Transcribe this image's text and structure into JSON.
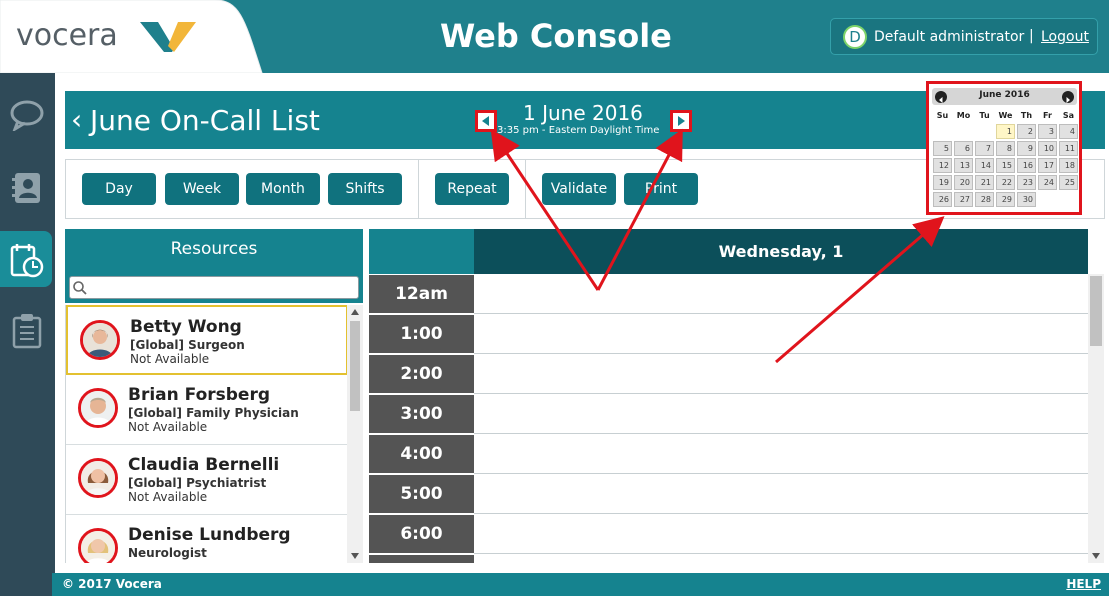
{
  "header": {
    "logo_text": "vocera",
    "title": "Web Console",
    "user_initial": "D",
    "user_name": "Default administrator",
    "separator": "|",
    "logout_label": "Logout"
  },
  "nav": {
    "items": [
      "chat-icon",
      "contacts-icon",
      "schedule-icon",
      "checklist-icon"
    ],
    "active": "schedule-icon"
  },
  "title_bar": {
    "back": "‹",
    "title": "June On-Call List",
    "date": "1 June 2016",
    "time_line": "3:35 pm - Eastern Daylight Time"
  },
  "toolbar": {
    "day": "Day",
    "week": "Week",
    "month": "Month",
    "shifts": "Shifts",
    "repeat": "Repeat",
    "validate": "Validate",
    "print": "Print"
  },
  "resources": {
    "header": "Resources",
    "search_placeholder": "",
    "items": [
      {
        "name": "Betty Wong",
        "role": "[Global] Surgeon",
        "status": "Not Available"
      },
      {
        "name": "Brian Forsberg",
        "role": "[Global] Family Physician",
        "status": "Not Available"
      },
      {
        "name": "Claudia Bernelli",
        "role": "[Global] Psychiatrist",
        "status": "Not Available"
      },
      {
        "name": "Denise Lundberg",
        "role": "Neurologist",
        "status": ""
      }
    ]
  },
  "schedule": {
    "day_header": "Wednesday, 1",
    "times": [
      "12am",
      "1:00",
      "2:00",
      "3:00",
      "4:00",
      "5:00",
      "6:00"
    ]
  },
  "calendar": {
    "month": "June 2016",
    "dow": [
      "Su",
      "Mo",
      "Tu",
      "We",
      "Th",
      "Fr",
      "Sa"
    ],
    "weeks": [
      [
        "",
        "",
        "",
        "1",
        "2",
        "3",
        "4"
      ],
      [
        "5",
        "6",
        "7",
        "8",
        "9",
        "10",
        "11"
      ],
      [
        "12",
        "13",
        "14",
        "15",
        "16",
        "17",
        "18"
      ],
      [
        "19",
        "20",
        "21",
        "22",
        "23",
        "24",
        "25"
      ],
      [
        "26",
        "27",
        "28",
        "29",
        "30",
        "",
        ""
      ]
    ],
    "today": "1"
  },
  "footer": {
    "copyright": "© 2017 Vocera",
    "help": "HELP"
  },
  "colors": {
    "teal": "#15838f",
    "dark_teal": "#0c4f5a",
    "nav_bg": "#2f4a58",
    "button": "#10727e",
    "annotation_red": "#e0141c"
  }
}
